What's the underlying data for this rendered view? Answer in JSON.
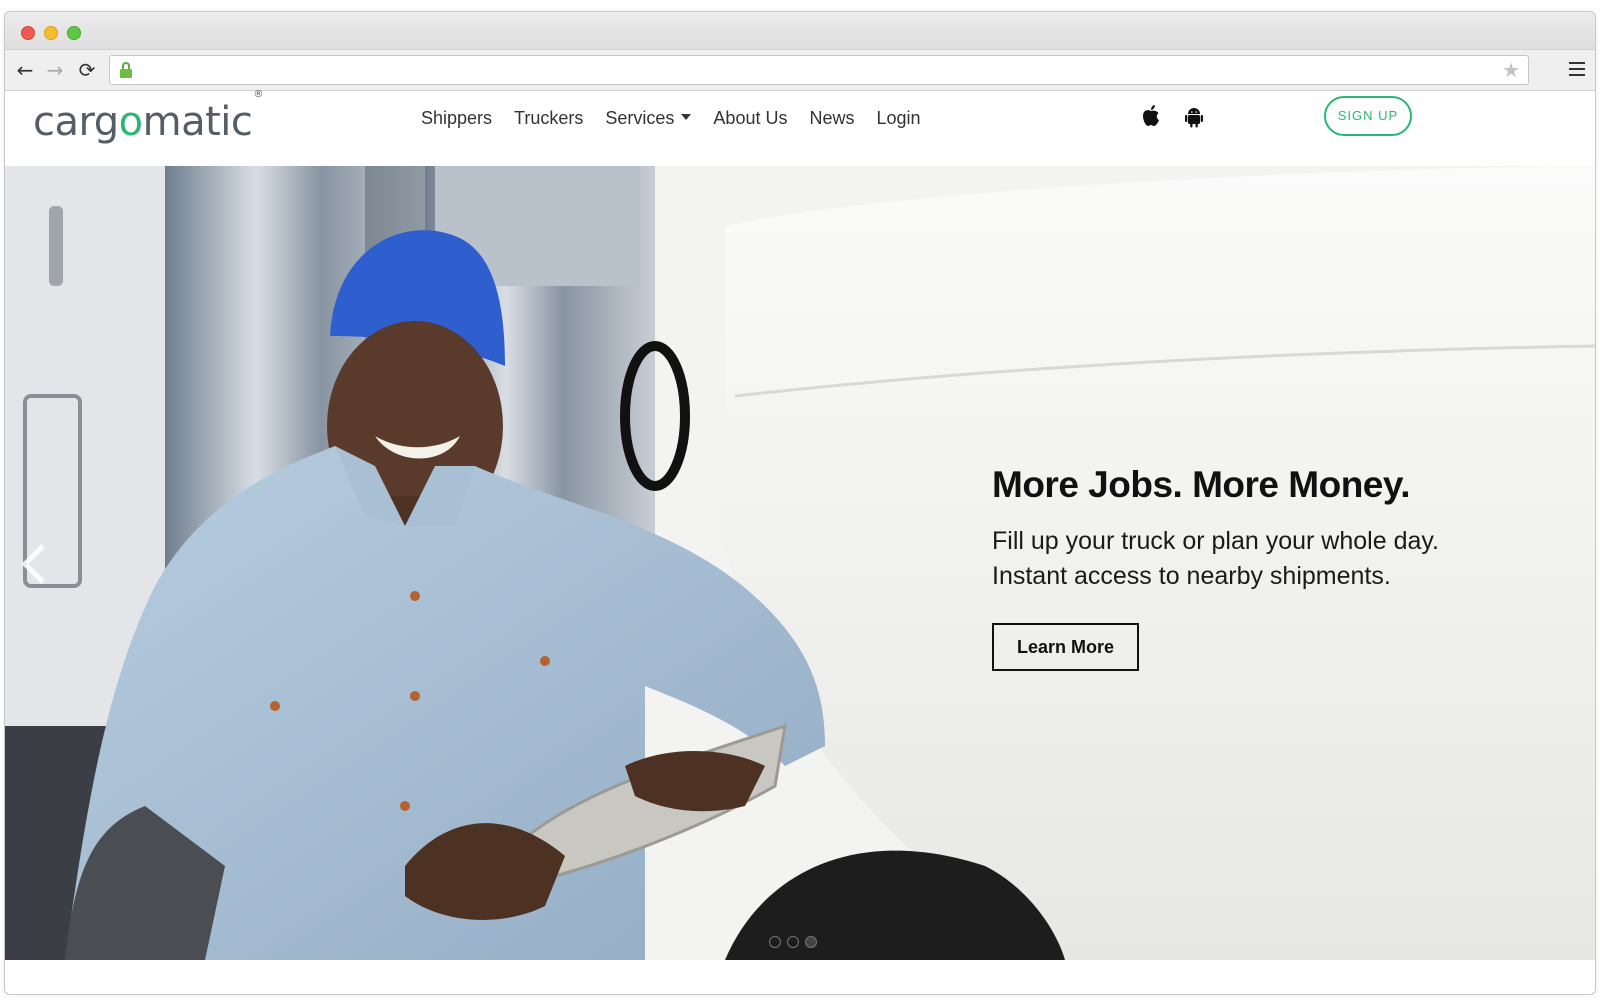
{
  "browser": {
    "address": "",
    "icons": [
      "back-arrow-icon",
      "forward-arrow-icon",
      "reload-icon",
      "lock-icon",
      "star-icon",
      "menu-icon"
    ]
  },
  "brand": {
    "logo_prefix": "carg",
    "logo_o": "o",
    "logo_suffix": "matic",
    "logo_mark": "®",
    "accent_color": "#2bb673"
  },
  "nav": {
    "items": [
      {
        "label": "Shippers"
      },
      {
        "label": "Truckers"
      },
      {
        "label": "Services"
      },
      {
        "label": "About Us"
      },
      {
        "label": "News"
      },
      {
        "label": "Login"
      }
    ],
    "app_icons": [
      "apple-icon",
      "android-icon"
    ],
    "signup_label": "SIGN UP"
  },
  "hero": {
    "title": "More Jobs. More Money.",
    "line1": "Fill up your truck or plan your whole day.",
    "line2": "Instant access to nearby shipments.",
    "cta_label": "Learn More",
    "slides": 3,
    "active_slide": 3
  }
}
